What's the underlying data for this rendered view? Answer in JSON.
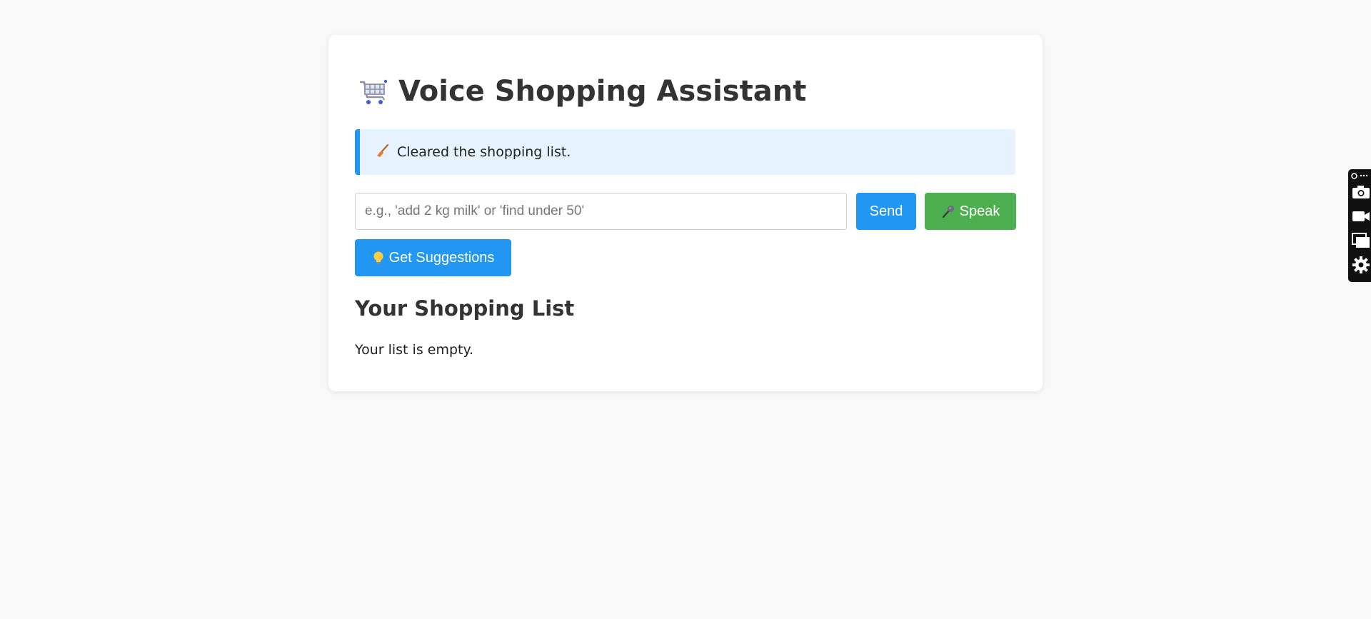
{
  "header": {
    "title": "Voice Shopping Assistant",
    "icon": "shopping-cart-icon"
  },
  "status": {
    "icon": "broom-icon",
    "message": "Cleared the shopping list."
  },
  "command": {
    "placeholder": "e.g., 'add 2 kg milk' or 'find under 50'",
    "value": ""
  },
  "buttons": {
    "send_label": "Send",
    "speak_label": "Speak",
    "speak_icon": "microphone-icon",
    "suggest_label": "Get Suggestions",
    "suggest_icon": "lightbulb-icon"
  },
  "list": {
    "heading": "Your Shopping List",
    "empty_message": "Your list is empty."
  },
  "side_toolbar": {
    "items": [
      "screenshot-camera-icon",
      "video-record-icon",
      "windows-icon",
      "settings-gear-icon"
    ]
  },
  "colors": {
    "primary": "#2196f3",
    "success": "#4caf50",
    "status_bg": "#e6f2fd",
    "page_bg": "#f8f8f8"
  }
}
